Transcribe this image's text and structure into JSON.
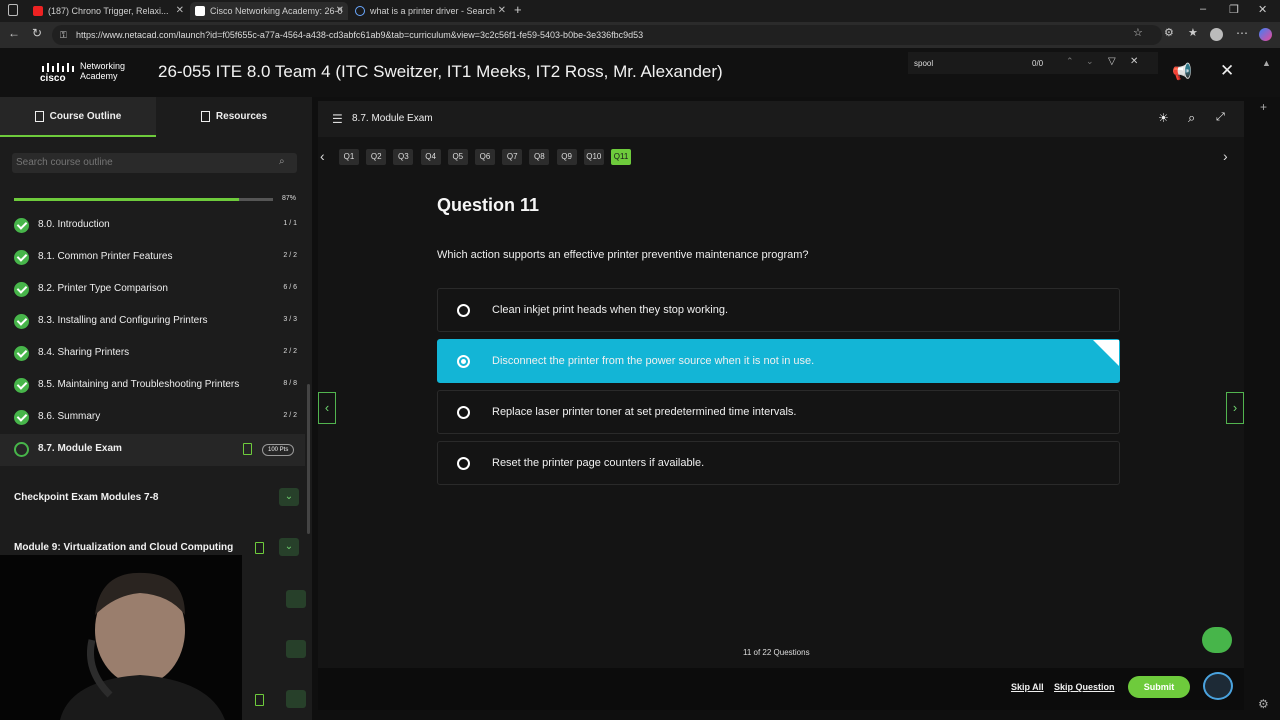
{
  "browser": {
    "tabs": [
      {
        "title": "(187) Chrono Trigger, Relaxi...",
        "active": false
      },
      {
        "title": "Cisco Networking Academy: 26-0",
        "active": true
      },
      {
        "title": "what is a printer driver - Search",
        "active": false
      }
    ],
    "url": "https://www.netacad.com/launch?id=f05f655c-a77a-4564-a438-cd3abfc61ab9&tab=curriculum&view=3c2c56f1-fe59-5403-b0be-3e336fbc9d53"
  },
  "header": {
    "logo_line1": "Networking",
    "logo_line2": "Academy",
    "logo_brand": "cisco",
    "course_title": "26-055 ITE 8.0 Team 4 (ITC Sweitzer, IT1 Meeks, IT2 Ross, Mr. Alexander)",
    "find_query": "spool",
    "find_count": "0/0"
  },
  "sidebar": {
    "tabs": [
      {
        "label": "Course Outline"
      },
      {
        "label": "Resources"
      }
    ],
    "search_placeholder": "Search course outline",
    "progress_label": "87%",
    "progress_value": 0.87,
    "lessons": [
      {
        "name": "8.0. Introduction",
        "count": "1 / 1"
      },
      {
        "name": "8.1. Common Printer Features",
        "count": "2 / 2"
      },
      {
        "name": "8.2. Printer Type Comparison",
        "count": "6 / 6"
      },
      {
        "name": "8.3. Installing and Configuring Printers",
        "count": "3 / 3"
      },
      {
        "name": "8.4. Sharing Printers",
        "count": "2 / 2"
      },
      {
        "name": "8.5. Maintaining and Troubleshooting Printers",
        "count": "8 / 8"
      },
      {
        "name": "8.6. Summary",
        "count": "2 / 2"
      }
    ],
    "current_lesson": {
      "name": "8.7. Module Exam",
      "badge": "100 Pts"
    },
    "modules": [
      {
        "name": "Checkpoint Exam Modules 7-8"
      },
      {
        "name": "Module 9: Virtualization and Cloud Computing"
      }
    ]
  },
  "main": {
    "breadcrumb": "8.7. Module Exam",
    "question_tabs": [
      "Q1",
      "Q2",
      "Q3",
      "Q4",
      "Q5",
      "Q6",
      "Q7",
      "Q8",
      "Q9",
      "Q10",
      "Q11"
    ],
    "current_tab_index": 10,
    "question_title": "Question 11",
    "question_text": "Which action supports an effective printer preventive maintenance program?",
    "options": [
      {
        "text": "Clean inkjet print heads when they stop working.",
        "selected": false
      },
      {
        "text": "Disconnect the printer from the power source when it is not in use.",
        "selected": true
      },
      {
        "text": "Replace laser printer toner at set predetermined time intervals.",
        "selected": false
      },
      {
        "text": "Reset the printer page counters if available.",
        "selected": false
      }
    ],
    "counter": "11 of 22 Questions",
    "footer": {
      "skip_all": "Skip All",
      "skip_question": "Skip Question",
      "submit": "Submit"
    }
  },
  "colors": {
    "accent_green": "#6ecb3c",
    "selected_option": "#13b5d6",
    "check_green": "#47b54a"
  }
}
